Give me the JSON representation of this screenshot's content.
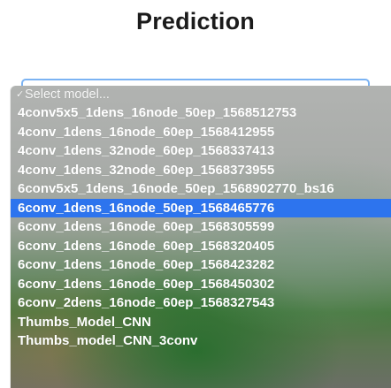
{
  "header": {
    "title": "Prediction"
  },
  "model_select": {
    "placeholder": "Select model...",
    "check_glyph": "✓",
    "highlighted_index": 5,
    "options": [
      "4conv5x5_1dens_16node_50ep_1568512753",
      "4conv_1dens_16node_60ep_1568412955",
      "4conv_1dens_32node_60ep_1568337413",
      "4conv_1dens_32node_60ep_1568373955",
      "6conv5x5_1dens_16node_50ep_1568902770_bs16",
      "6conv_1dens_16node_50ep_1568465776",
      "6conv_1dens_16node_60ep_1568305599",
      "6conv_1dens_16node_60ep_1568320405",
      "6conv_1dens_16node_60ep_1568423282",
      "6conv_1dens_16node_60ep_1568450302",
      "6conv_2dens_16node_60ep_1568327543",
      "Thumbs_Model_CNN",
      "Thumbs_model_CNN_3conv"
    ]
  },
  "colors": {
    "highlight": "#2d74ee",
    "select_border": "#7bb3f3"
  }
}
